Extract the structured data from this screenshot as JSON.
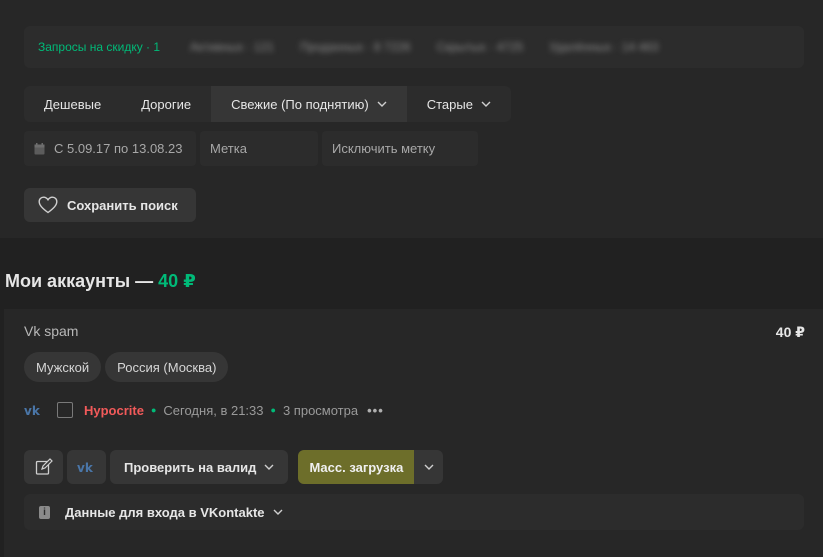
{
  "discount": {
    "label": "Запросы на скидку · 1"
  },
  "stats": [
    "Активных · 121",
    "Проданных · 8 7226",
    "Скрытых · 4725",
    "Удалённых · 14 463"
  ],
  "sort": {
    "cheap": "Дешевые",
    "expensive": "Дорогие",
    "fresh": "Свежие (По поднятию)",
    "old": "Старые"
  },
  "filters": {
    "date": "С 5.09.17 по 13.08.23",
    "tag_placeholder": "Метка",
    "exclude_placeholder": "Исключить метку"
  },
  "save_search": "Сохранить поиск",
  "section": {
    "title": "Мои аккаунты — ",
    "amount": "40 ₽"
  },
  "account": {
    "title": "Vk spam",
    "price": "40 ₽",
    "tags": [
      "Мужской",
      "Россия (Москва)"
    ],
    "seller": "Hypocrite",
    "time": "Сегодня, в 21:33",
    "views": "3 просмотра"
  },
  "actions": {
    "check": "Проверить на валид",
    "mass": "Масс. загрузка"
  },
  "login": {
    "label": "Данные для входа в VKontakte"
  },
  "icons": {
    "calendar": "calendar-icon",
    "heart": "heart-icon",
    "vk": "vk-icon",
    "edit": "edit-icon",
    "info": "info-icon",
    "chevron": "chevron-down-icon"
  },
  "colors": {
    "accent_green": "#00ba78",
    "seller_red": "#f25a5a",
    "mass_button": "#6d6e2a",
    "vk_blue": "#4a76a8"
  }
}
